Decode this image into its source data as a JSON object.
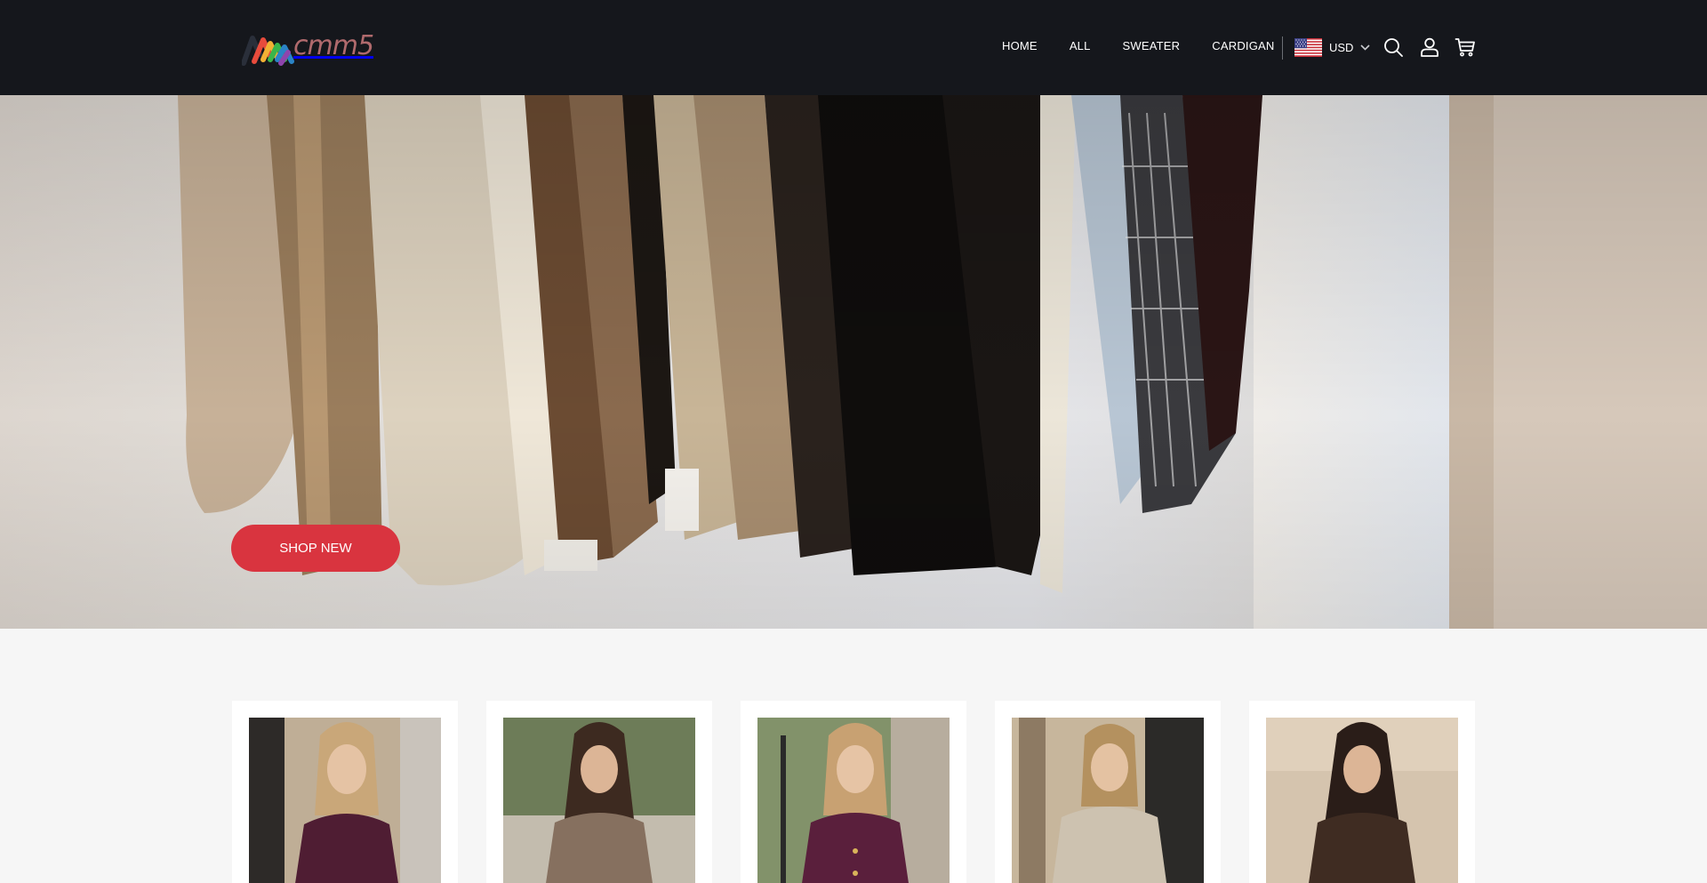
{
  "brand": {
    "name": "cmm5",
    "tagline": "cmm5",
    "logo_colors": [
      "#e84b3c",
      "#f2b134",
      "#39b54a",
      "#2a83c6",
      "#8e44ad"
    ]
  },
  "nav": {
    "items": [
      "HOME",
      "ALL",
      "SWEATER",
      "CARDIGAN"
    ]
  },
  "currency": {
    "label": "USD",
    "flag": "us-flag-icon"
  },
  "header_icons": [
    "search-icon",
    "user-icon",
    "cart-icon"
  ],
  "hero": {
    "cta_label": "SHOP NEW"
  },
  "colors": {
    "header_bg": "#15171c",
    "accent": "#d9343f",
    "page_bg": "#f6f6f6"
  },
  "products": [
    {
      "sweater_color": "#4f1d33",
      "hair": "#c9a779",
      "backdrop": "city-street"
    },
    {
      "sweater_color": "#86705f",
      "hair": "#3d2a20",
      "backdrop": "park"
    },
    {
      "sweater_color": "#5a1f3c",
      "hair": "#c8a172",
      "backdrop": "park-street"
    },
    {
      "sweater_color": "#cdc2b0",
      "hair": "#b4915f",
      "backdrop": "storefront"
    },
    {
      "sweater_color": "#3f2c22",
      "hair": "#2a1d18",
      "backdrop": "stone-wall"
    }
  ]
}
